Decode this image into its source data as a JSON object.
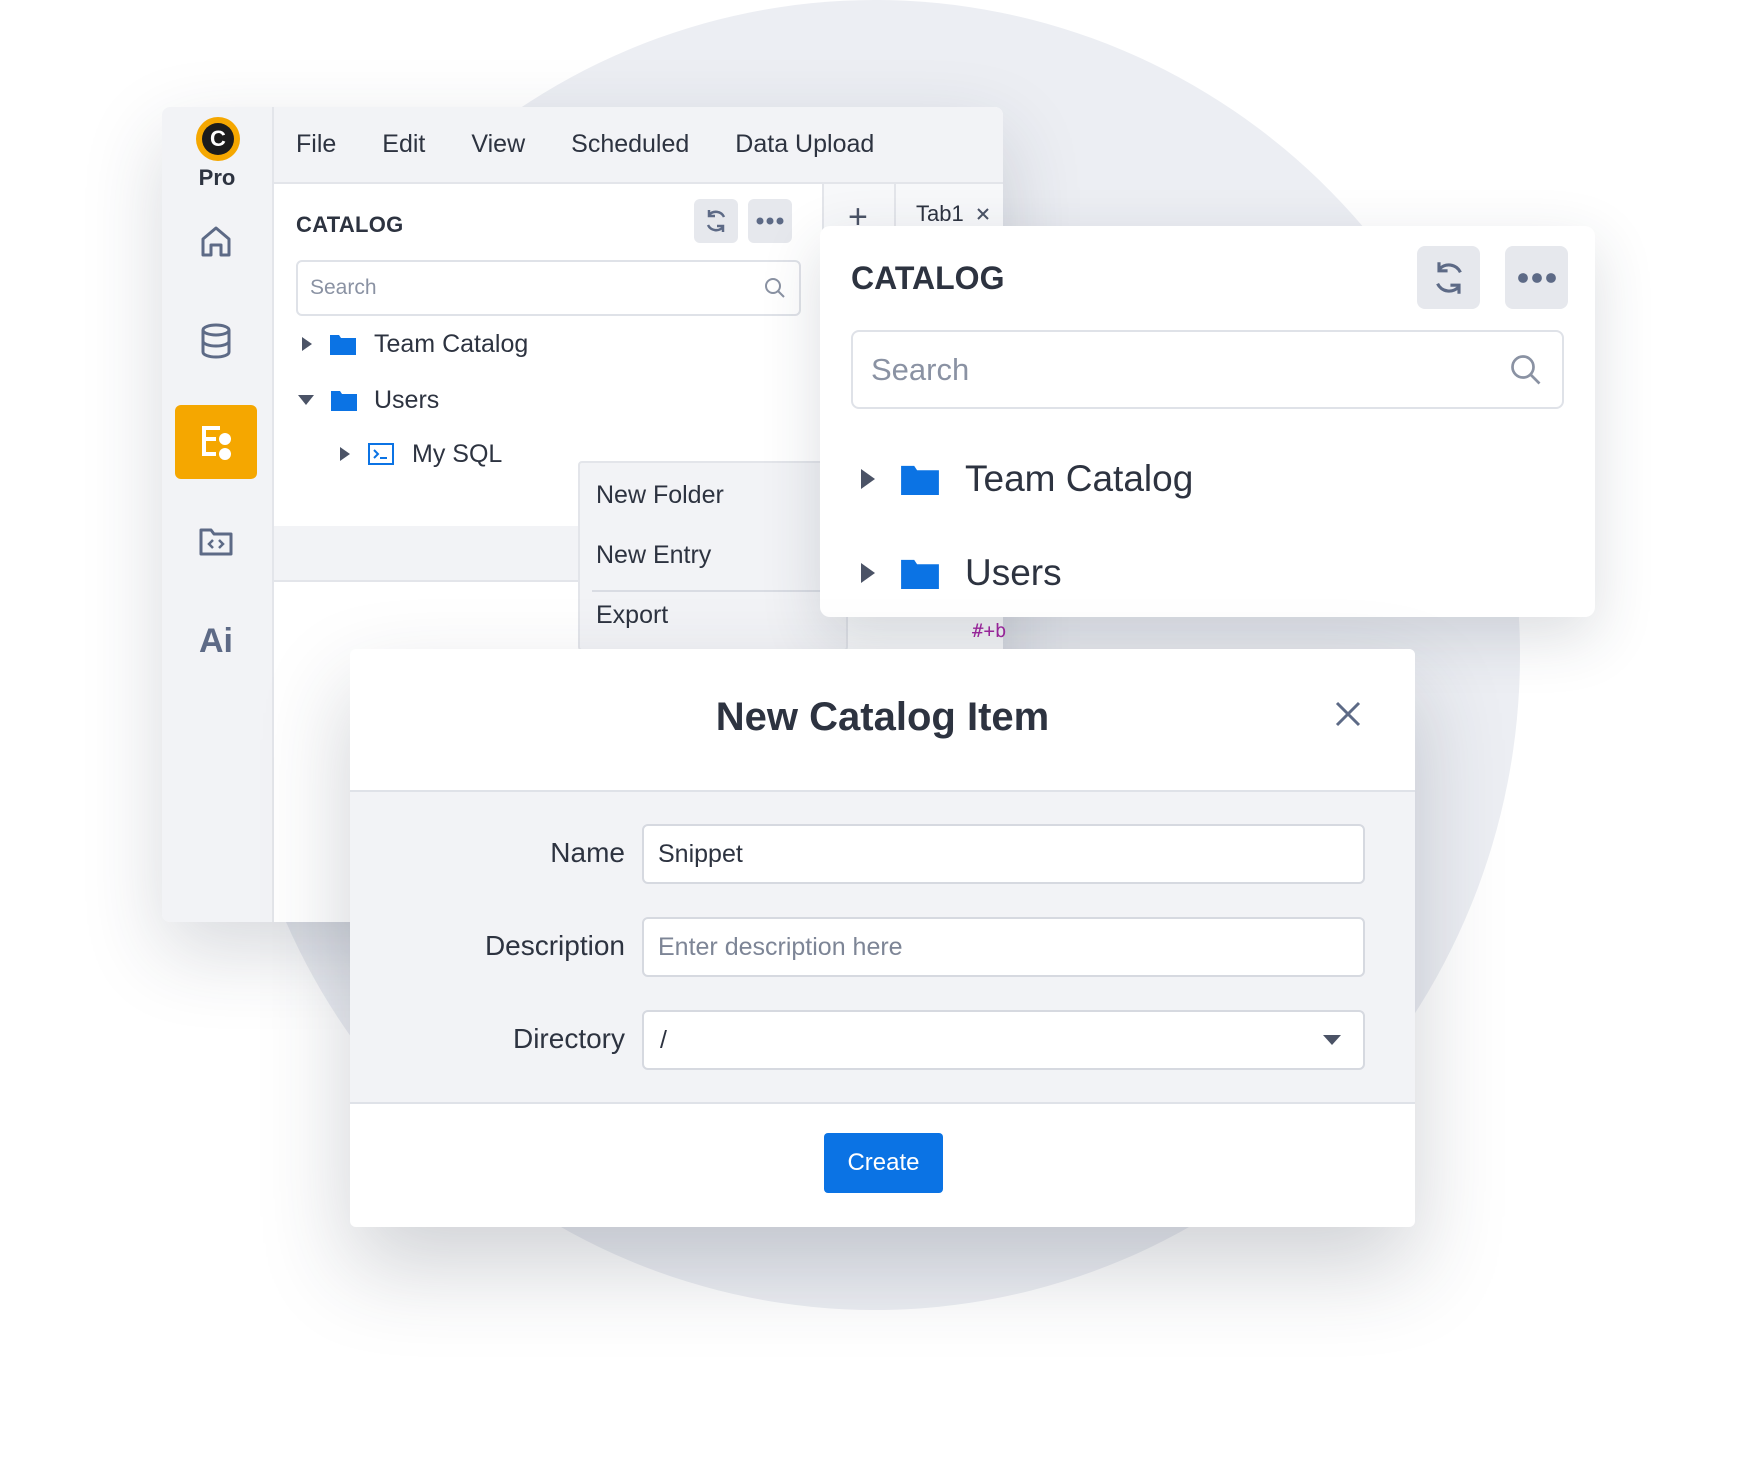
{
  "app": {
    "logo_letter": "C",
    "edition": "Pro",
    "rail": {
      "ai_label": "Ai"
    },
    "menu": [
      "File",
      "Edit",
      "View",
      "Scheduled",
      "Data Upload"
    ],
    "catalog": {
      "title": "CATALOG",
      "search_placeholder": "Search",
      "tree": {
        "team_catalog": "Team Catalog",
        "users": "Users",
        "my_sql": "My SQL"
      }
    },
    "tabs": {
      "add": "+",
      "tab1": "Tab1"
    },
    "context_menu": {
      "new_folder": "New Folder",
      "new_entry": "New Entry",
      "export": "Export"
    },
    "code_fragment": "#+b"
  },
  "catalog_card": {
    "title": "CATALOG",
    "search_placeholder": "Search",
    "items": [
      "Team Catalog",
      "Users"
    ]
  },
  "modal": {
    "title": "New Catalog Item",
    "fields": {
      "name_label": "Name",
      "name_value": "Snippet",
      "description_label": "Description",
      "description_placeholder": "Enter description here",
      "directory_label": "Directory",
      "directory_value": "/"
    },
    "create_label": "Create"
  },
  "colors": {
    "accent": "#f5a700",
    "primary_button": "#0b73e4",
    "folder_blue": "#0b73e4",
    "text": "#2d3340",
    "background_circle": "#eceef3"
  }
}
